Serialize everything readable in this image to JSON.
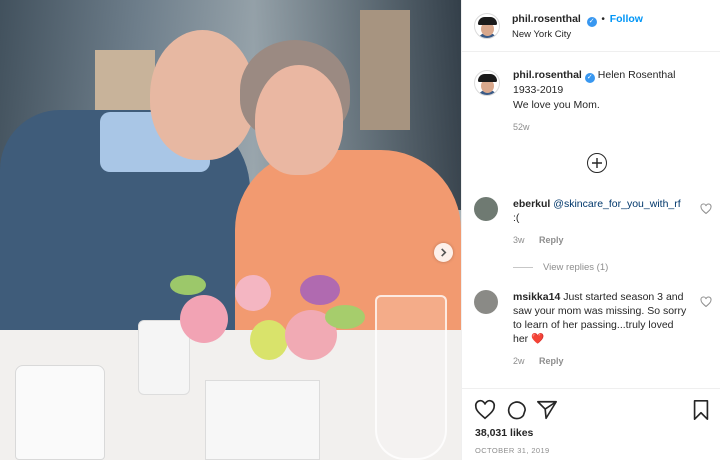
{
  "post": {
    "author": "phil.rosenthal",
    "location": "New York City",
    "follow_label": "Follow",
    "verified_glyph": "✓",
    "photo_description_icon": "photo-carousel-next-icon"
  },
  "caption": {
    "author": "phil.rosenthal",
    "text_line1": "Helen Rosenthal",
    "text_line2": "1933-2019",
    "text_line3": "We love you Mom.",
    "age": "52w"
  },
  "comments": [
    {
      "author": "eberkul",
      "mention": "@skincare_for_you_with_rf",
      "text": ":(",
      "age": "3w",
      "reply_label": "Reply",
      "view_replies": "View replies (1)"
    },
    {
      "author": "msikka14",
      "text": "Just started season 3 and saw your mom was missing. So sorry to learn of her passing...truly loved her ❤️",
      "age": "2w",
      "reply_label": "Reply"
    }
  ],
  "footer": {
    "likes": "38,031 likes",
    "date": "OCTOBER 31, 2019"
  },
  "colors": {
    "link_blue": "#0095f6",
    "verified_blue": "#3897f0",
    "muted_gray": "#8e8e8e",
    "text_dark": "#262626"
  },
  "icons": [
    "chevron-right-icon",
    "verified-badge-icon",
    "add-comment-icon",
    "heart-icon",
    "comment-icon",
    "share-icon",
    "bookmark-icon"
  ]
}
